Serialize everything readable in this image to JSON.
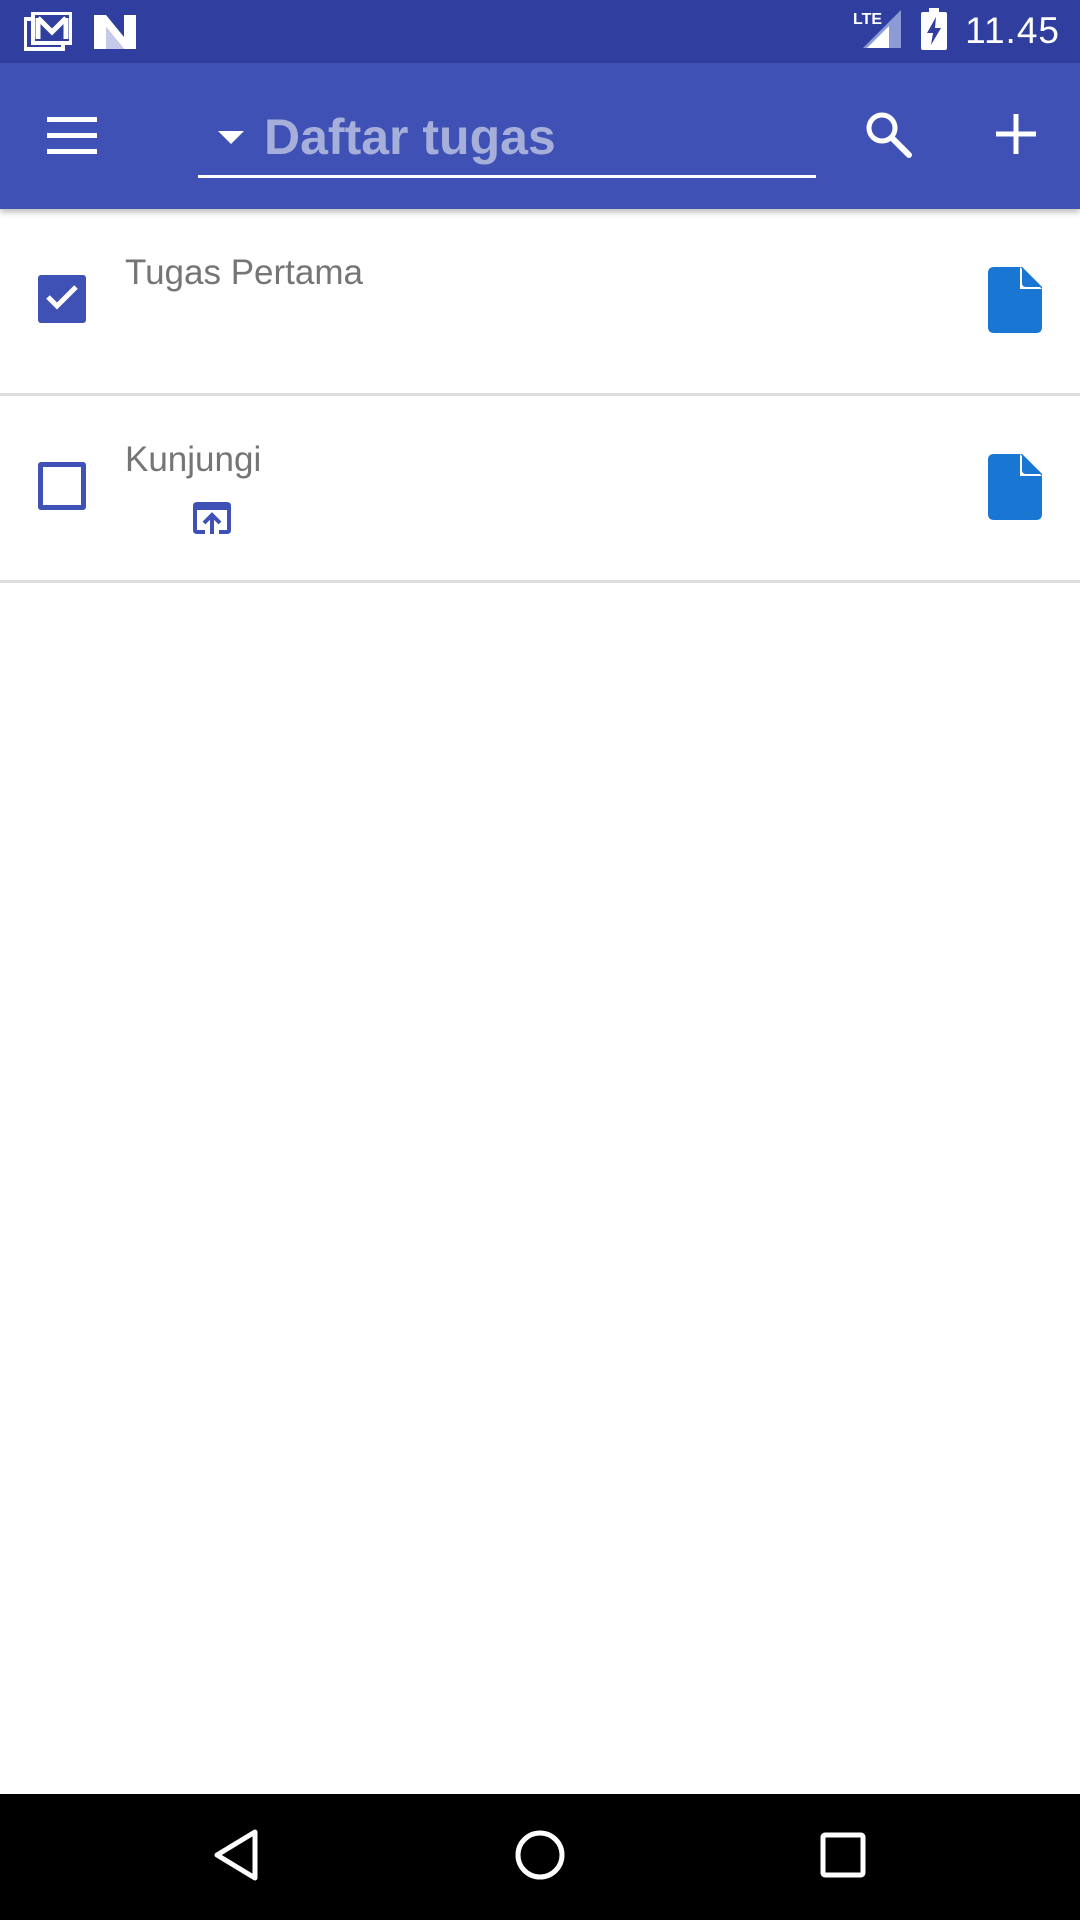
{
  "status_bar": {
    "time": "11.45",
    "network_label": "LTE",
    "icons": [
      "gmail-icon",
      "n-notification-icon",
      "lte-signal-icon",
      "battery-charging-icon"
    ]
  },
  "app_bar": {
    "list_selector_label": "Daftar tugas",
    "icons": [
      "menu-icon",
      "dropdown-caret-icon",
      "search-icon",
      "add-icon"
    ]
  },
  "tasks": [
    {
      "title": "Tugas Pertama",
      "checked": true,
      "icons": [
        "checkbox-checked-icon",
        "document-icon"
      ]
    },
    {
      "title": "Kunjungi",
      "checked": false,
      "icons": [
        "checkbox-unchecked-icon",
        "open-in-app-icon",
        "document-icon"
      ]
    }
  ],
  "nav_bar": {
    "icons": [
      "back-icon",
      "home-icon",
      "recents-icon"
    ]
  },
  "colors": {
    "status_bar": "#303F9F",
    "primary": "#3F51B5",
    "selector_text": "#A6AFD9",
    "task_text": "#757575",
    "document_icon": "#1976D2",
    "divider": "#DDDDDD"
  }
}
